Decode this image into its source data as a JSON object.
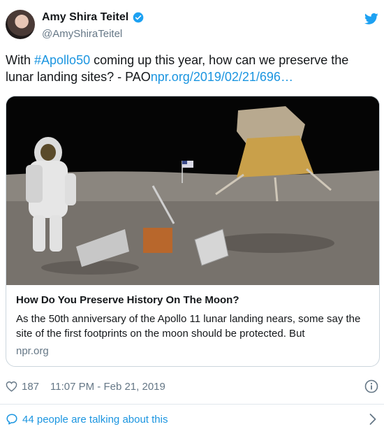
{
  "author": {
    "display_name": "Amy Shira Teitel",
    "handle": "@AmyShiraTeitel",
    "verified": true
  },
  "tweet": {
    "text_before": "With ",
    "hashtag": "#Apollo50",
    "text_middle": " coming up this year, how can we preserve the lunar landing sites? - PAO",
    "link": "npr.org/2019/02/21/696…"
  },
  "card": {
    "title": "How Do You Preserve History On The Moon?",
    "description": "As the 50th anniversary of the Apollo 11 lunar landing nears, some say the site of the first footprints on the moon should be protected. But",
    "domain": "npr.org"
  },
  "meta": {
    "like_count": "187",
    "timestamp": "11:07 PM - Feb 21, 2019"
  },
  "footer": {
    "talking_label": "44 people are talking about this"
  },
  "colors": {
    "link": "#1b95e0",
    "muted": "#657786",
    "border": "#ccd6dd"
  },
  "icons": [
    "verified-badge-icon",
    "twitter-bird-icon",
    "heart-icon",
    "info-icon",
    "speech-bubble-icon",
    "chevron-right-icon"
  ]
}
